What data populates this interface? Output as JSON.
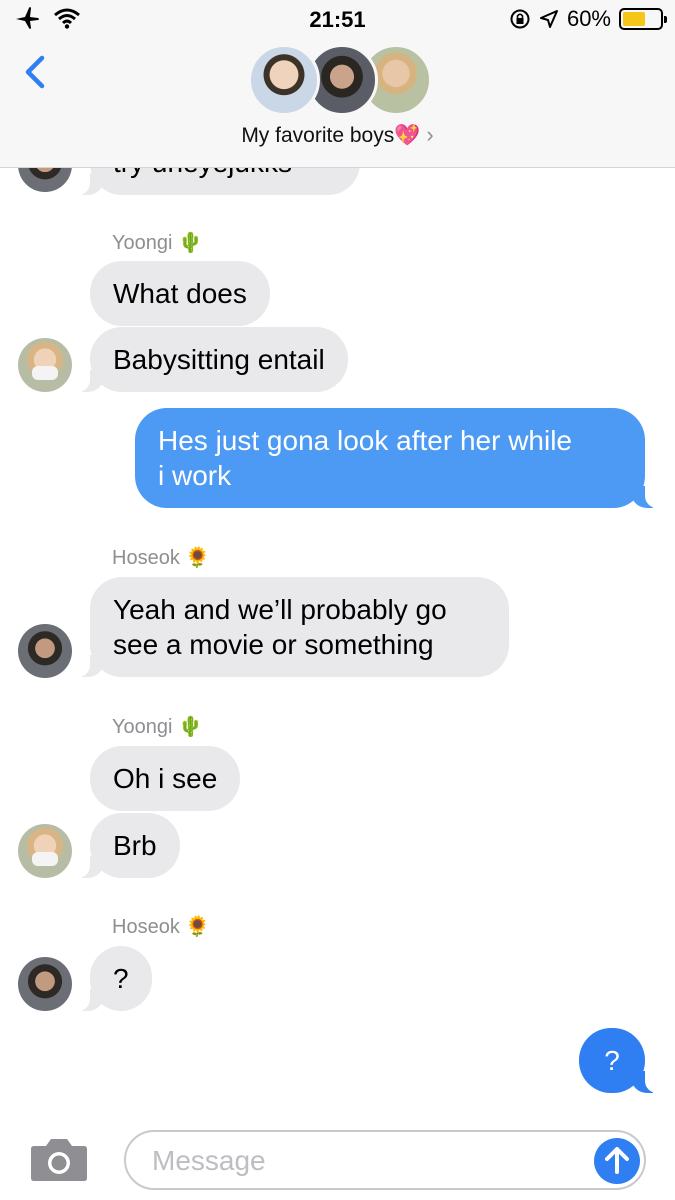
{
  "status_bar": {
    "time": "21:51",
    "battery": "60%",
    "battery_level": 0.6
  },
  "header": {
    "group_name": "My favorite boys💖",
    "chevron": "›"
  },
  "messages": {
    "top_partial": "try uneyejukks",
    "sender_yoongi_1": "Yoongi 🌵",
    "m1": "What does",
    "m2": "Babysitting entail",
    "out1_line1": "Hes just gona look after her while",
    "out1_line2": "i work",
    "sender_hoseok_1": "Hoseok 🌻",
    "m3_line1": "Yeah and we’ll probably go",
    "m3_line2": "see a movie or something",
    "sender_yoongi_2": "Yoongi 🌵",
    "m4": "Oh i see",
    "m5": "Brb",
    "sender_hoseok_2": "Hoseok 🌻",
    "m6": "?",
    "out2": "?"
  },
  "composer": {
    "placeholder": "Message"
  },
  "colors": {
    "accent": "#2f7ff2",
    "incoming_bubble": "#e9e9eb",
    "battery": "#f5c518"
  }
}
